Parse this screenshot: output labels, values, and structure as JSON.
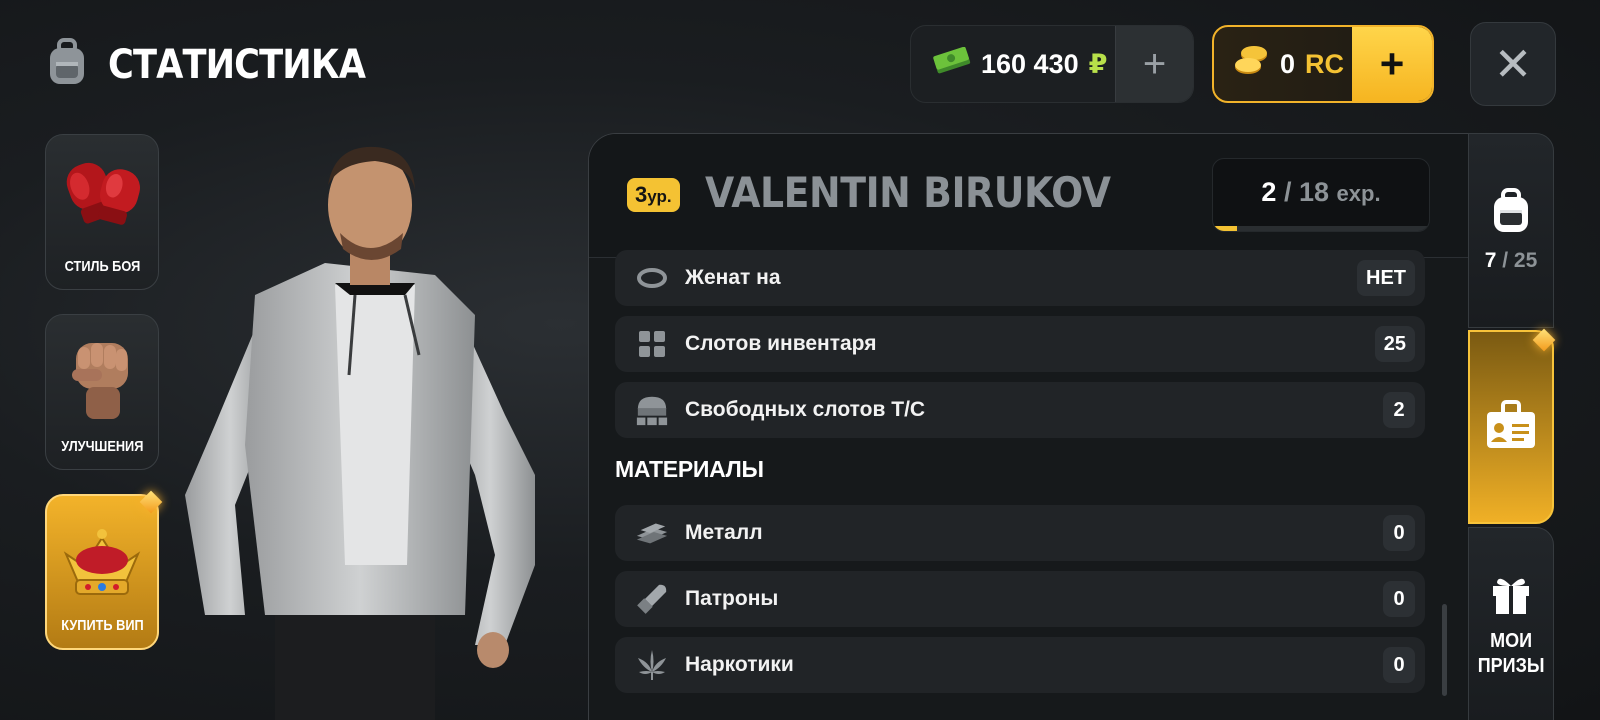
{
  "header": {
    "title": "СТАТИСТИКА",
    "icon": "backpack-icon"
  },
  "currency": {
    "money_amount": "160 430",
    "money_symbol": "₽",
    "money_plus": "+",
    "rc_amount": "0",
    "rc_unit": "RC",
    "rc_plus": "+"
  },
  "close_label": "✕",
  "side_menu": [
    {
      "label": "СТИЛЬ БОЯ",
      "icon": "boxing-gloves-icon"
    },
    {
      "label": "УЛУЧШЕНИЯ",
      "icon": "fist-icon"
    },
    {
      "label": "КУПИТЬ ВИП",
      "icon": "crown-icon"
    }
  ],
  "player": {
    "level": "3",
    "level_unit": "ур.",
    "name": "VALENTIN BIRUKOV",
    "exp_current": "2",
    "exp_separator": "/",
    "exp_total": "18",
    "exp_unit": "exp.",
    "exp_progress": 0.11
  },
  "stats": [
    {
      "label": "Женат на",
      "value": "НЕТ",
      "icon": "ring-icon"
    },
    {
      "label": "Слотов инвентаря",
      "value": "25",
      "icon": "grid-icon"
    },
    {
      "label": "Свободных слотов Т/С",
      "value": "2",
      "icon": "garage-icon"
    }
  ],
  "materials_title": "МАТЕРИАЛЫ",
  "materials": [
    {
      "label": "Металл",
      "value": "0",
      "icon": "metal-icon"
    },
    {
      "label": "Патроны",
      "value": "0",
      "icon": "bullet-icon"
    },
    {
      "label": "Наркотики",
      "value": "0",
      "icon": "leaf-icon"
    }
  ],
  "tabs": {
    "inventory_current": "7",
    "inventory_separator": "/",
    "inventory_total": "25",
    "inventory_icon": "backpack-icon",
    "stats_icon": "id-card-icon",
    "prizes_line1": "МОИ",
    "prizes_line2": "ПРИЗЫ",
    "prizes_icon": "gift-icon"
  },
  "colors": {
    "accent": "#f4c233",
    "ruble": "#b8e04a",
    "panel": "#16191b",
    "row": "#212427"
  }
}
